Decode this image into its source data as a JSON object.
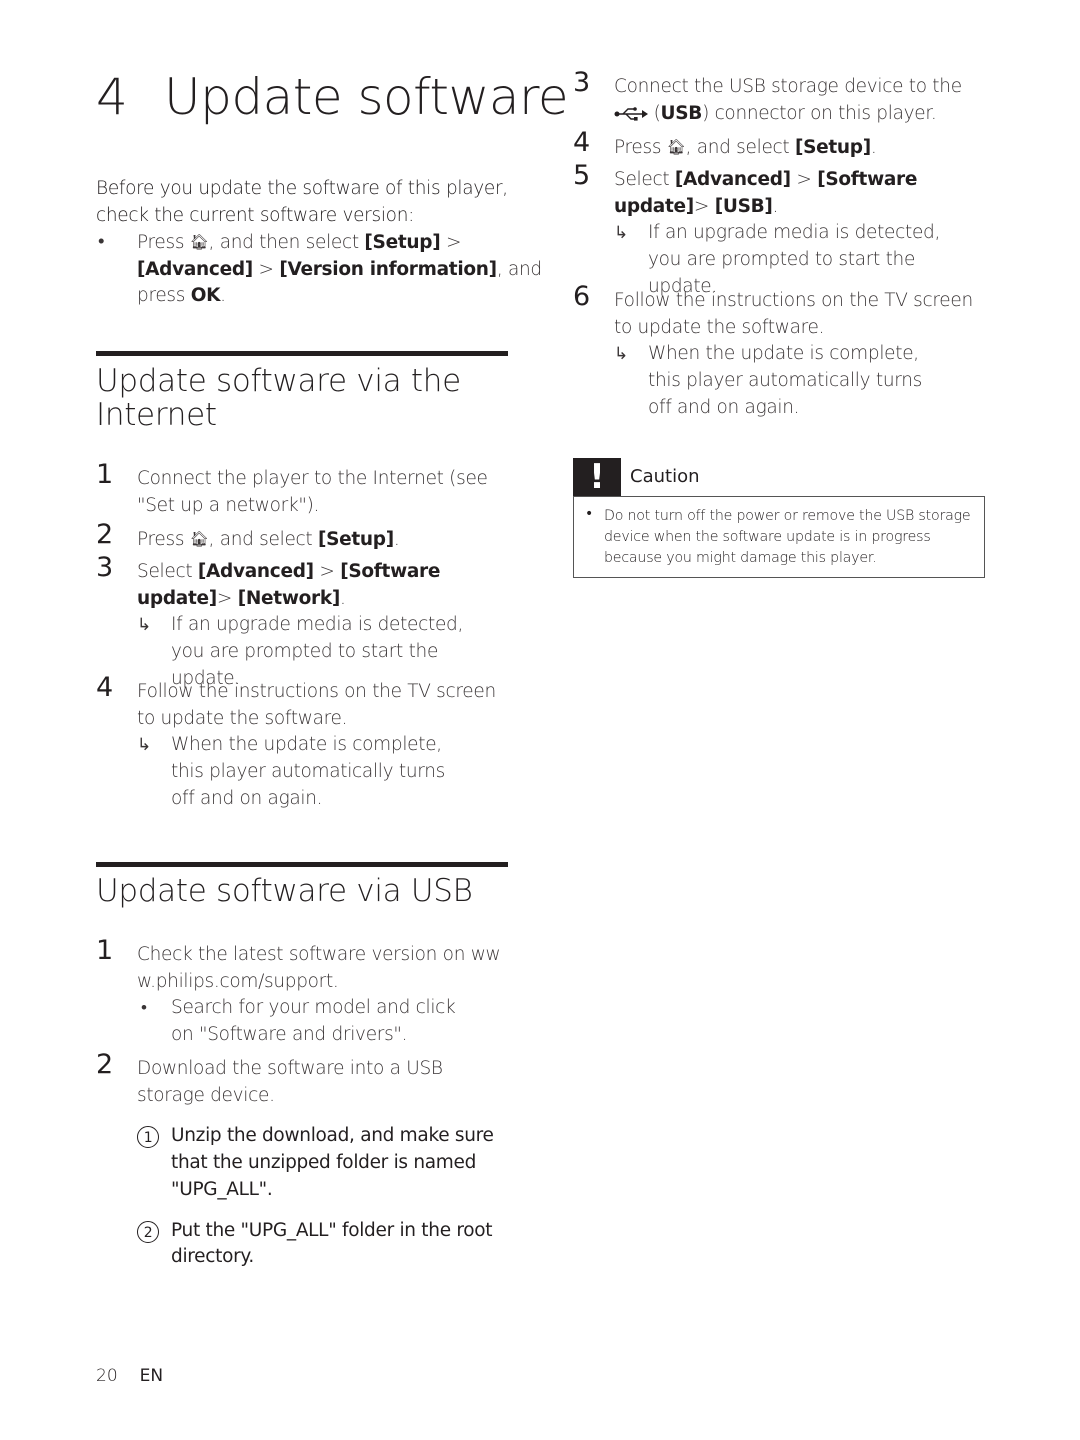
{
  "chapter": {
    "number": "4",
    "title": "Update software"
  },
  "intro": {
    "text": "Before you update the software of this player, check the current software version:",
    "bullet": {
      "pre": "Press ",
      "icon": "home-icon",
      "mid1": ", and then select ",
      "b1": "[Setup]",
      "sep1": " > ",
      "b2": "[Advanced]",
      "sep2": " > ",
      "b3": "[Version information]",
      "mid2": ", and press ",
      "b4": "OK",
      "end": "."
    }
  },
  "internet": {
    "heading": "Update software via the Internet",
    "steps": [
      {
        "n": "1",
        "text": "Connect the player to the Internet (see \"Set up a network\")."
      },
      {
        "n": "2",
        "pre": "Press ",
        "mid": ", and select ",
        "b1": "[Setup]",
        "end": "."
      },
      {
        "n": "3",
        "pre": "Select ",
        "b1": "[Advanced]",
        "sep1": " > ",
        "b2": "[Software update]",
        "sep2": "> ",
        "b3": "[Network]",
        "end": ".",
        "result": "If an upgrade media is detected, you are prompted to start the update."
      },
      {
        "n": "4",
        "text": "Follow the instructions on the TV screen to update the software.",
        "result": "When the update is complete, this player automatically turns off and on again."
      }
    ]
  },
  "usb": {
    "heading": "Update software via USB",
    "steps": [
      {
        "n": "1",
        "text": "Check the latest software version on www.philips.com/support.",
        "bullet": "Search for your model and click on \"Software and drivers\"."
      },
      {
        "n": "2",
        "text": "Download the software into a USB storage device.",
        "substeps": [
          {
            "n": "1",
            "text": "Unzip the download, and make sure that the unzipped folder is named \"UPG_ALL\"."
          },
          {
            "n": "2",
            "text": "Put the \"UPG_ALL\" folder in the root directory."
          }
        ]
      },
      {
        "n": "3",
        "pre": "Connect the USB storage device to the ",
        "icon": "usb-icon",
        "b1": "USB",
        "end": " connector on this player."
      },
      {
        "n": "4",
        "pre": "Press ",
        "mid": ", and select ",
        "b1": "[Setup]",
        "end": "."
      },
      {
        "n": "5",
        "pre": "Select ",
        "b1": "[Advanced]",
        "sep1": " > ",
        "b2": "[Software update]",
        "sep2": "> ",
        "b3": "[USB]",
        "end": ".",
        "result": "If an upgrade media is detected, you are prompted to start the update."
      },
      {
        "n": "6",
        "text": "Follow the instructions on the TV screen to update the software.",
        "result": "When the update is complete, this player automatically turns off and on again."
      }
    ]
  },
  "caution": {
    "icon": "!",
    "label": "Caution",
    "text": "Do not turn off the power or remove the USB storage device when the software update is in progress because you might damage this player."
  },
  "footer": {
    "page": "20",
    "lang": "EN"
  }
}
